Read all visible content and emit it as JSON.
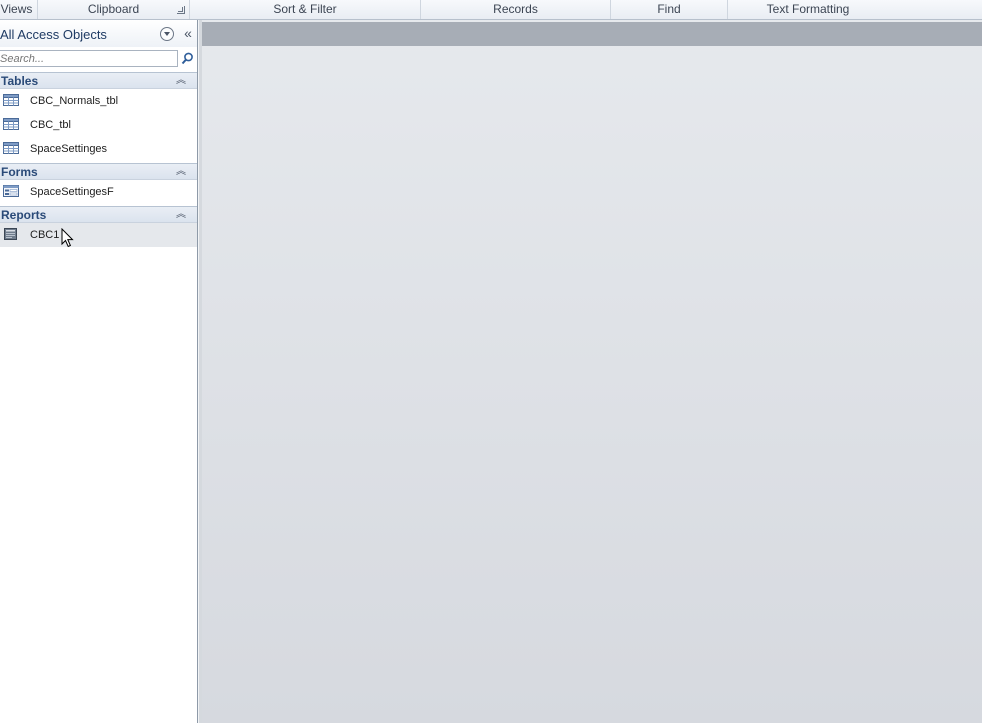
{
  "ribbon": {
    "groups": [
      {
        "label": "Views"
      },
      {
        "label": "Clipboard"
      },
      {
        "label": "Sort & Filter"
      },
      {
        "label": "Records"
      },
      {
        "label": "Find"
      },
      {
        "label": "Text Formatting"
      }
    ]
  },
  "nav": {
    "title": "All Access Objects",
    "search_placeholder": "Search...",
    "groups": [
      {
        "label": "Tables",
        "items": [
          {
            "label": "CBC_Normals_tbl",
            "icon": "table-icon"
          },
          {
            "label": "CBC_tbl",
            "icon": "table-icon"
          },
          {
            "label": "SpaceSettinges",
            "icon": "table-icon"
          }
        ]
      },
      {
        "label": "Forms",
        "items": [
          {
            "label": "SpaceSettingesF",
            "icon": "form-icon"
          }
        ]
      },
      {
        "label": "Reports",
        "items": [
          {
            "label": "CBC1",
            "icon": "report-icon",
            "selected": true
          }
        ]
      }
    ]
  },
  "colors": {
    "group_header_text": "#2a4a78",
    "workspace_tabbar": "#a7adb6",
    "workspace_bg": "#e6e9ed"
  }
}
